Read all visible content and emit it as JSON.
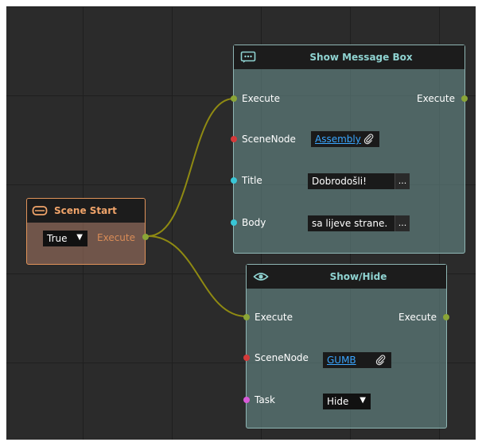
{
  "nodes": {
    "scene_start": {
      "title": "Scene Start",
      "dropdown_value": "True",
      "dropdown_arrow": "▼",
      "output_label": "Execute",
      "icon": "vr-headset-icon",
      "accent": "#e0935a"
    },
    "show_message_box": {
      "title": "Show Message Box",
      "icon": "message-dots-icon",
      "input_execute": "Execute",
      "output_execute": "Execute",
      "scenenode_label": "SceneNode",
      "scenenode_value": "Assembly",
      "title_label": "Title",
      "title_value": "Dobrodošli!",
      "body_label": "Body",
      "body_value": "sa lijeve strane.",
      "ellipsis": "..."
    },
    "show_hide": {
      "title": "Show/Hide",
      "icon": "eye-icon",
      "input_execute": "Execute",
      "output_execute": "Execute",
      "scenenode_label": "SceneNode",
      "scenenode_value": "GUMB",
      "task_label": "Task",
      "task_value": "Hide",
      "task_arrow": "▼"
    }
  },
  "colors": {
    "execute_port": "#8aa537",
    "scenenode_port": "#d43a3a",
    "string_port": "#39c6d6",
    "task_port": "#d95ad9",
    "wire": "#8f8a12",
    "header_text": "#8fd3d1"
  }
}
